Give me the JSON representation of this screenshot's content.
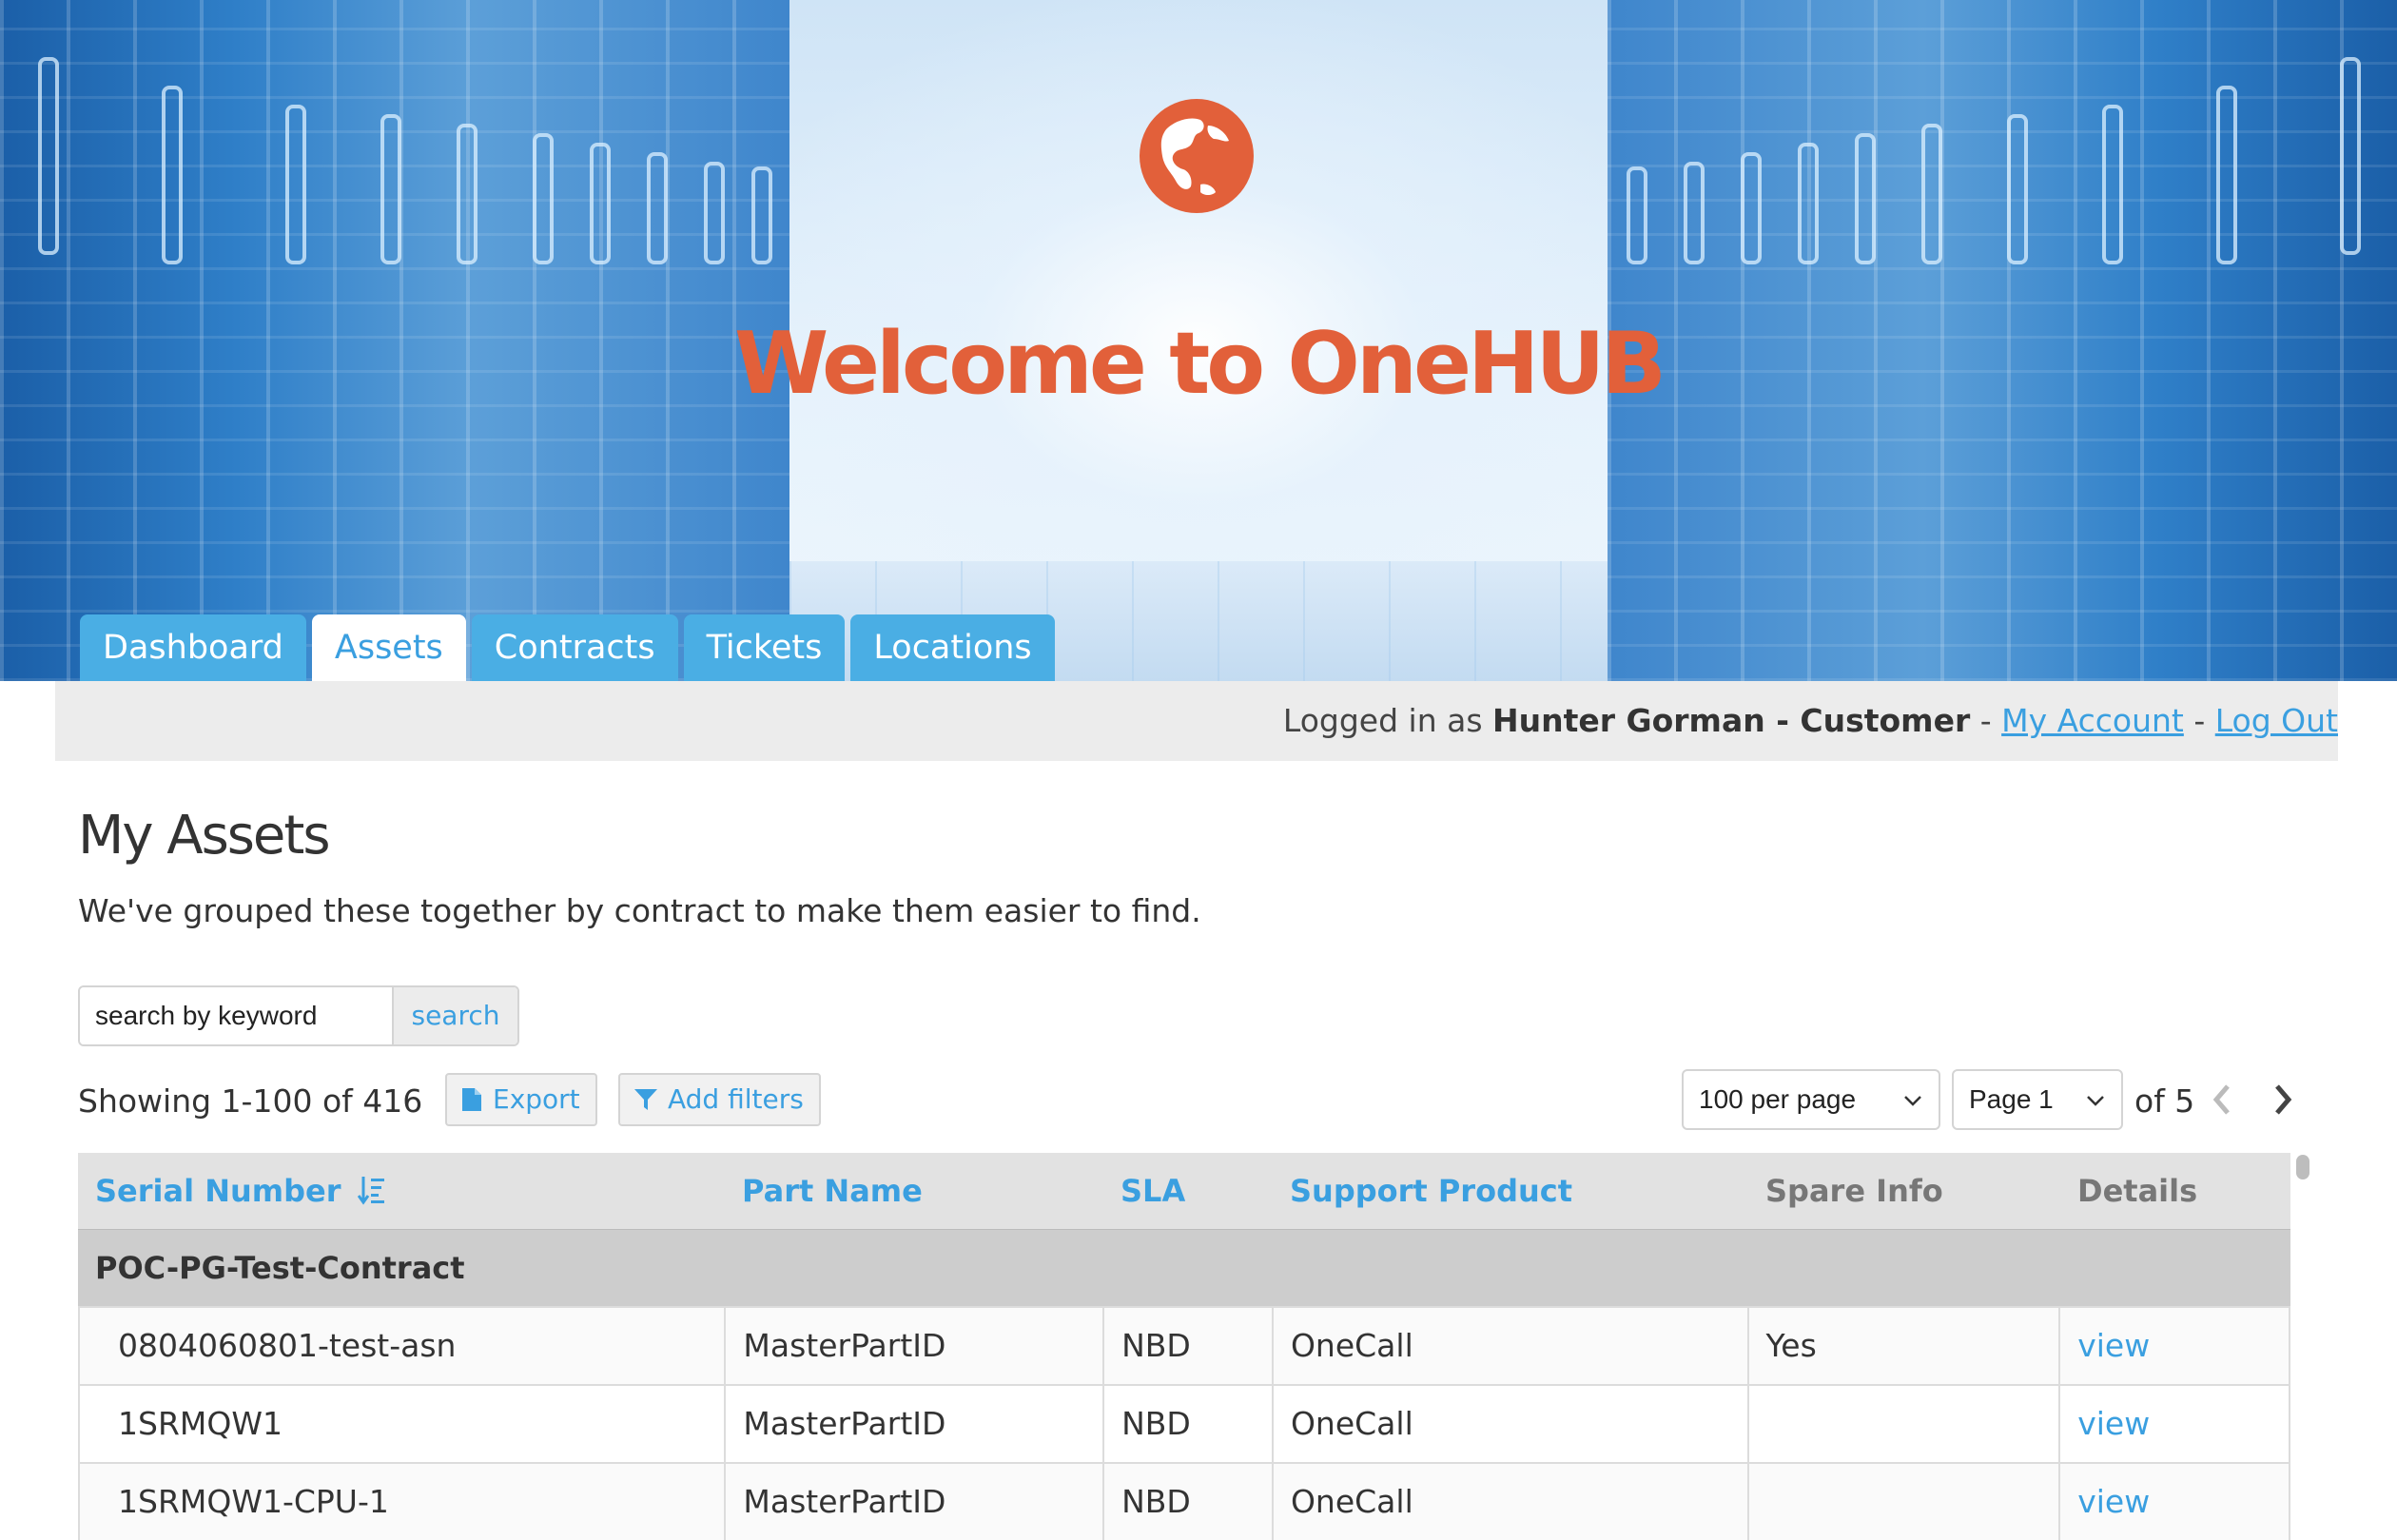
{
  "hero": {
    "welcome": "Welcome to OneHUB"
  },
  "nav": {
    "tabs": [
      {
        "label": "Dashboard",
        "active": false
      },
      {
        "label": "Assets",
        "active": true
      },
      {
        "label": "Contracts",
        "active": false
      },
      {
        "label": "Tickets",
        "active": false
      },
      {
        "label": "Locations",
        "active": false
      }
    ]
  },
  "userbar": {
    "prefix": "Logged in as ",
    "user": "Hunter Gorman - Customer",
    "sep1": " - ",
    "my_account": "My Account",
    "sep2": " - ",
    "log_out": "Log Out"
  },
  "page": {
    "title": "My Assets",
    "subtitle": "We've grouped these together by contract to make them easier to find."
  },
  "search": {
    "placeholder": "search by keyword",
    "button": "search"
  },
  "toolbar": {
    "showing": "Showing 1-100 of 416",
    "export": "Export",
    "add_filters": "Add filters",
    "per_page": "100 per page",
    "page": "Page 1",
    "of_pages": "of 5"
  },
  "table": {
    "headers": [
      "Serial Number",
      "Part Name",
      "SLA",
      "Support Product",
      "Spare Info",
      "Details"
    ],
    "group": "POC-PG-Test-Contract",
    "rows": [
      [
        "0804060801-test-asn",
        "MasterPartID",
        "NBD",
        "OneCall",
        "Yes",
        "view"
      ],
      [
        "1SRMQW1",
        "MasterPartID",
        "NBD",
        "OneCall",
        "",
        "view"
      ],
      [
        "1SRMQW1-CPU-1",
        "MasterPartID",
        "NBD",
        "OneCall",
        "",
        "view"
      ]
    ]
  },
  "colors": {
    "brand_orange": "#e2603a",
    "link_blue": "#3a9fe0",
    "tab_blue": "#4aaee4"
  }
}
